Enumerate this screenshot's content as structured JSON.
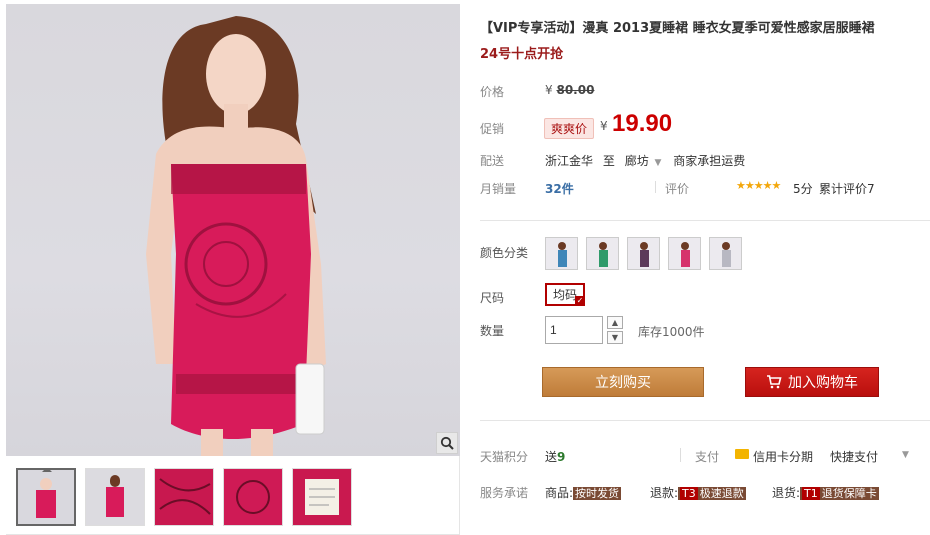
{
  "product": {
    "title": "【VIP专享活动】漫真 2013夏睡裙 睡衣女夏季可爱性感家居服睡裙",
    "subtitle": "24号十点开抢"
  },
  "price": {
    "label": "价格",
    "currency": "¥",
    "original": "80.00",
    "promo_label": "促销",
    "promo_tag": "爽爽价",
    "promo_price": "19.90"
  },
  "shipping": {
    "label": "配送",
    "from": "浙江金华",
    "to_word": "至",
    "to": "廊坊",
    "fee": "商家承担运费"
  },
  "sales": {
    "label": "月销量",
    "count": "32件",
    "rating_label": "评价",
    "stars": "★★★★★",
    "score": "5分",
    "review_count": "累计评价7"
  },
  "options": {
    "color_label": "颜色分类",
    "colors": [
      "#3f86b8",
      "#2f9a6a",
      "#5c3a5a",
      "#d6336c",
      "#b8b8c2"
    ],
    "size_label": "尺码",
    "size_value": "均码",
    "qty_label": "数量",
    "qty_value": "1",
    "stock": "库存1000件"
  },
  "actions": {
    "buy_now": "立刻购买",
    "add_cart": "加入购物车"
  },
  "points": {
    "label": "天猫积分",
    "prefix": "送",
    "value": "9",
    "pay_label": "支付",
    "installment": "信用卡分期",
    "quickpay": "快捷支付"
  },
  "service": {
    "label": "服务承诺",
    "goods_label": "商品:",
    "goods_tag": "按时发货",
    "refund_label": "退款:",
    "refund_id": "T3",
    "refund_tag": "极速退款",
    "return_label": "退货:",
    "return_id": "T1",
    "return_tag": "退货保障卡"
  },
  "colors": {
    "accent_red": "#cc0000",
    "buy_orange": "#c98440",
    "dress_pink": "#d81b5a"
  }
}
